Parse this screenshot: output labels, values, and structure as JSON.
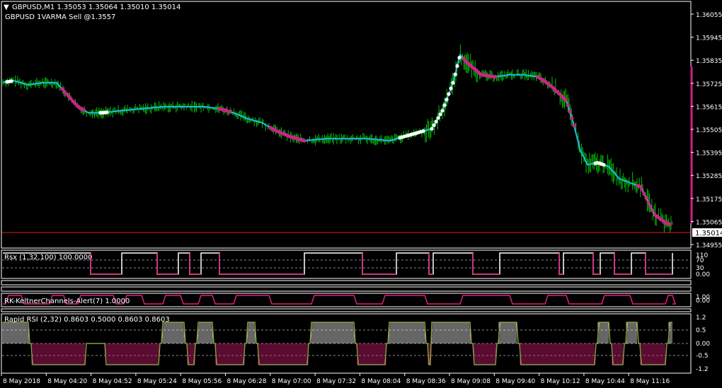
{
  "header": {
    "symbol_line": "GBPUSD,M1  1.35053 1.35064 1.35010 1.35014",
    "indicator_line": "GBPUSD 1VARMA Sell @1.3557"
  },
  "main_axis": {
    "labels": [
      "1.36055",
      "1.35945",
      "1.35835",
      "1.35725",
      "1.35615",
      "1.35505",
      "1.35395",
      "1.35285",
      "1.35175",
      "1.35065",
      "1.34955"
    ],
    "current_price": "1.35014"
  },
  "rsx_panel": {
    "label": "Rsx (1,32,100) 100.0000",
    "axis": [
      "110",
      "70",
      "30",
      "0.00"
    ]
  },
  "keltner_panel": {
    "label": "RK-KeltnerChannels-Alert(7) 1.0000",
    "axis": [
      "1.00",
      "0.00"
    ]
  },
  "rapid_rsi_panel": {
    "label": "Rapid RSI (2,32) 0.8603 0.5000 0.8603 0.8603",
    "axis": [
      "1.2",
      "0.5",
      "0.00",
      "-0.5",
      "-1.2"
    ]
  },
  "time_axis": [
    "8 May 2018",
    "8 May 04:20",
    "8 May 04:52",
    "8 May 05:24",
    "8 May 05:56",
    "8 May 06:28",
    "8 May 07:00",
    "8 May 07:32",
    "8 May 08:04",
    "8 May 08:36",
    "8 May 09:08",
    "8 May 09:40",
    "8 May 10:12",
    "8 May 10:44",
    "8 May 11:16"
  ],
  "colors": {
    "candle": "#00c000",
    "ma_line": "#20b8e8",
    "sell_dots": "#d0208a",
    "buy_dots": "#ffffff",
    "price_line": "#e02020",
    "osc_up": "#ffffff",
    "osc_down": "#e0207a"
  },
  "chart_data": {
    "type": "line",
    "ylim": [
      1.349,
      1.3612
    ],
    "close_path": [
      [
        0,
        1.3572
      ],
      [
        20,
        1.3573
      ],
      [
        40,
        1.3571
      ],
      [
        60,
        1.3572
      ],
      [
        80,
        1.3572
      ],
      [
        95,
        1.3566
      ],
      [
        110,
        1.356
      ],
      [
        125,
        1.3557
      ],
      [
        145,
        1.3557
      ],
      [
        170,
        1.3558
      ],
      [
        200,
        1.3559
      ],
      [
        230,
        1.356
      ],
      [
        260,
        1.356
      ],
      [
        290,
        1.356
      ],
      [
        310,
        1.3559
      ],
      [
        330,
        1.3557
      ],
      [
        350,
        1.3554
      ],
      [
        370,
        1.3552
      ],
      [
        390,
        1.3548
      ],
      [
        410,
        1.3545
      ],
      [
        430,
        1.3543
      ],
      [
        460,
        1.3544
      ],
      [
        490,
        1.3544
      ],
      [
        520,
        1.3544
      ],
      [
        550,
        1.3543
      ],
      [
        570,
        1.3545
      ],
      [
        590,
        1.3547
      ],
      [
        610,
        1.3549
      ],
      [
        625,
        1.3558
      ],
      [
        640,
        1.3572
      ],
      [
        650,
        1.3586
      ],
      [
        660,
        1.3582
      ],
      [
        680,
        1.3576
      ],
      [
        700,
        1.3575
      ],
      [
        720,
        1.3576
      ],
      [
        740,
        1.3576
      ],
      [
        760,
        1.3575
      ],
      [
        780,
        1.357
      ],
      [
        800,
        1.3563
      ],
      [
        810,
        1.3552
      ],
      [
        820,
        1.3538
      ],
      [
        830,
        1.3531
      ],
      [
        845,
        1.3532
      ],
      [
        860,
        1.353
      ],
      [
        875,
        1.3524
      ],
      [
        890,
        1.3522
      ],
      [
        905,
        1.352
      ],
      [
        915,
        1.3513
      ],
      [
        925,
        1.3506
      ],
      [
        940,
        1.3502
      ],
      [
        948,
        1.3501
      ]
    ]
  }
}
